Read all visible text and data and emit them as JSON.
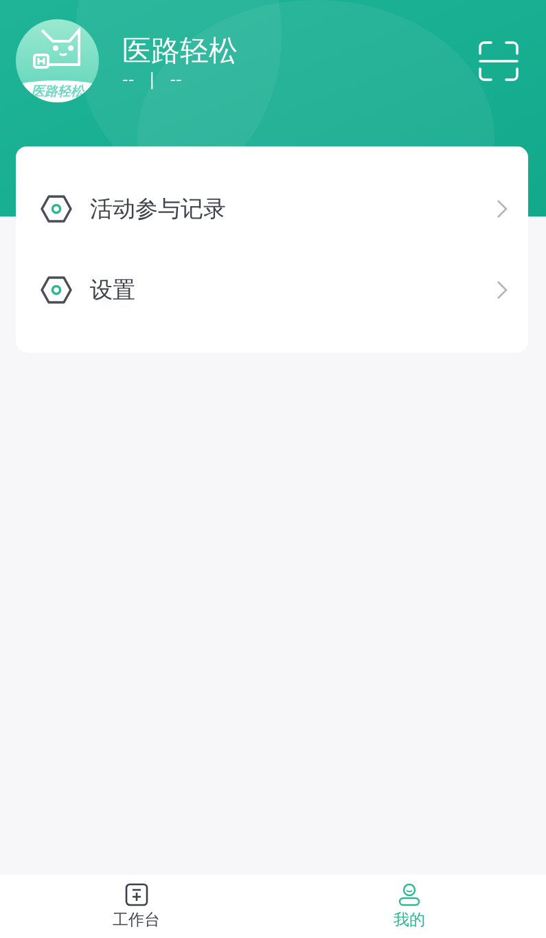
{
  "header": {
    "avatar_text": "医路轻松",
    "title": "医路轻松",
    "subtitle_left": "--",
    "subtitle_separator": "|",
    "subtitle_right": "--"
  },
  "menu": [
    {
      "label": "活动参与记录"
    },
    {
      "label": "设置"
    }
  ],
  "tabbar": [
    {
      "label": "工作台",
      "kind": "workbench",
      "selected": false
    },
    {
      "label": "我的",
      "kind": "profile",
      "selected": true
    }
  ]
}
